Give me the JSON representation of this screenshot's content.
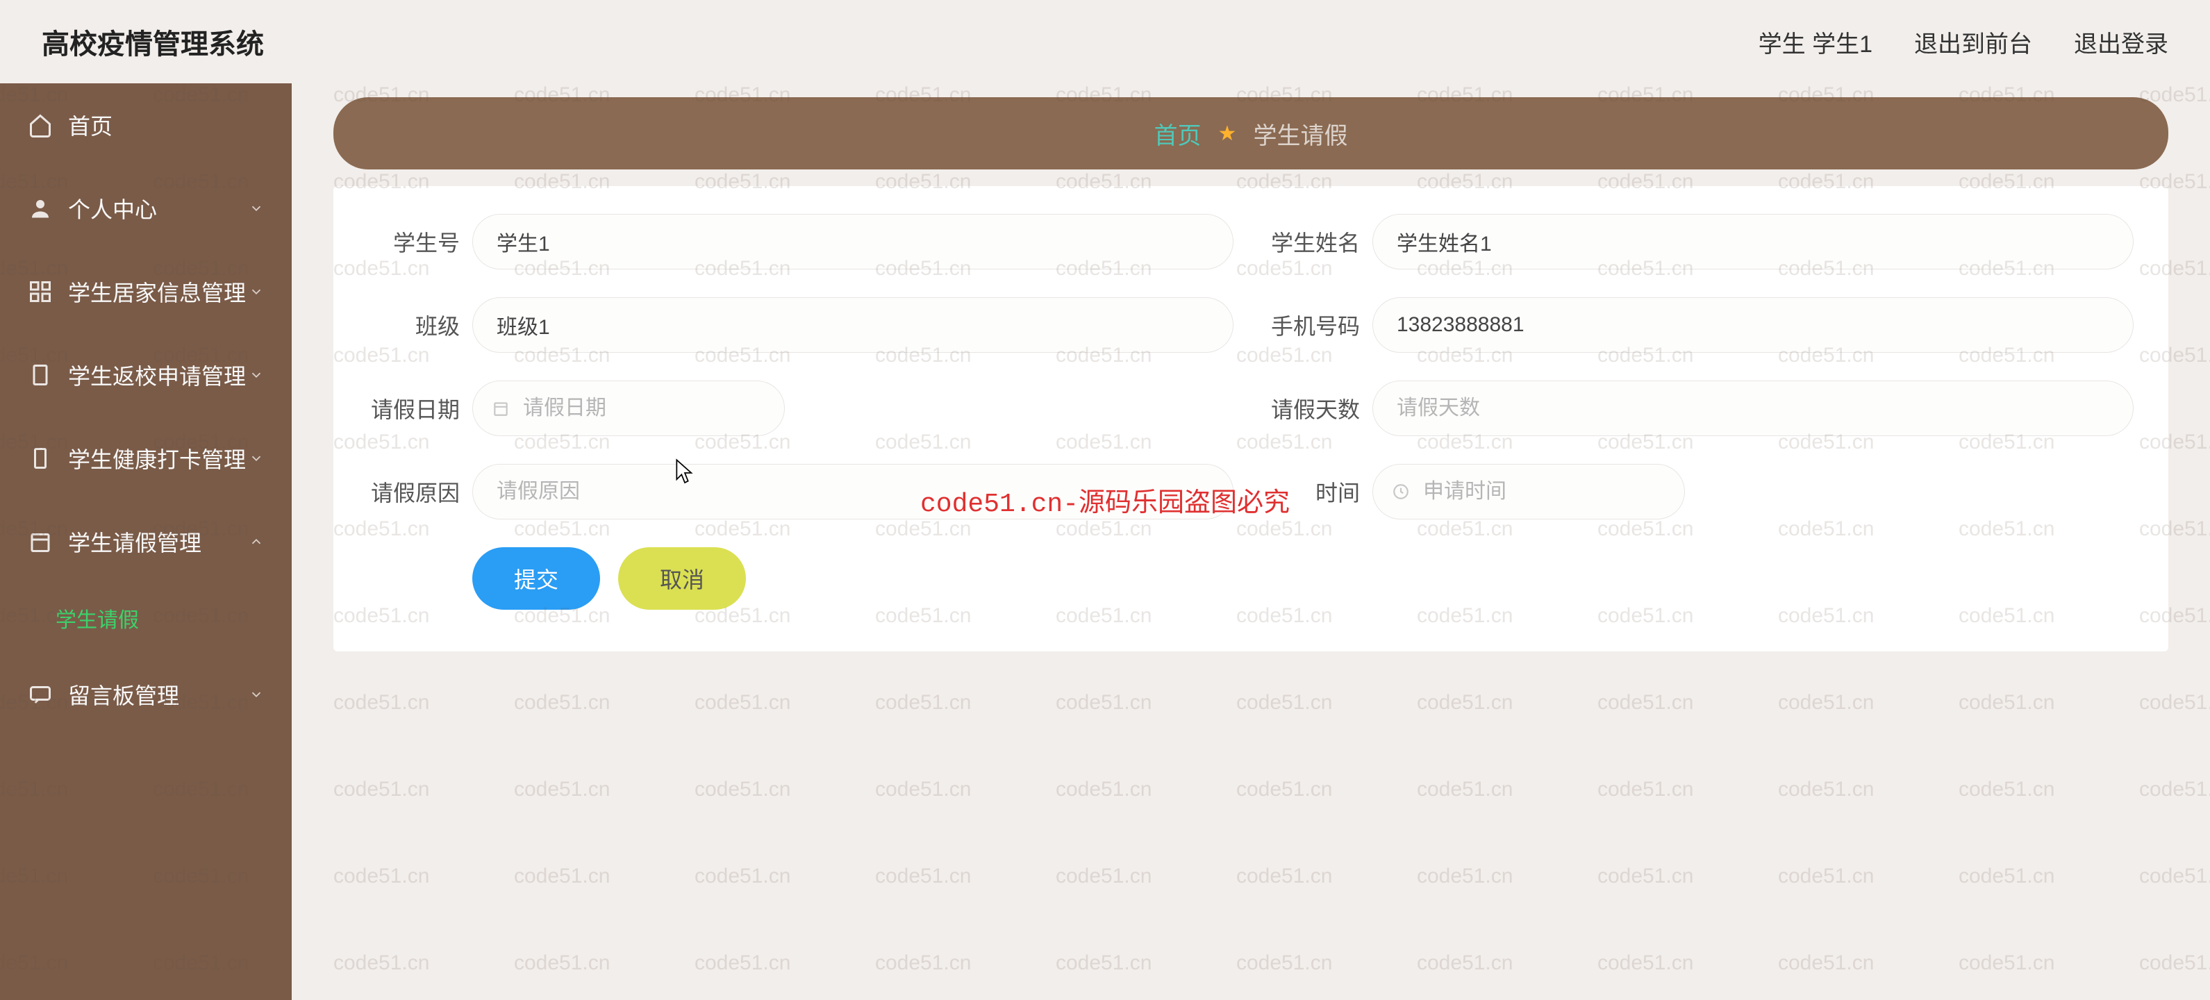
{
  "header": {
    "title": "高校疫情管理系统",
    "user_label": "学生 学生1",
    "logout_front": "退出到前台",
    "logout": "退出登录"
  },
  "sidebar": {
    "items": [
      {
        "label": "首页",
        "icon": "home-icon",
        "expandable": false
      },
      {
        "label": "个人中心",
        "icon": "user-icon",
        "expandable": true,
        "expanded": false
      },
      {
        "label": "学生居家信息管理",
        "icon": "grid-icon",
        "expandable": true,
        "expanded": false
      },
      {
        "label": "学生返校申请管理",
        "icon": "doc-icon",
        "expandable": true,
        "expanded": false
      },
      {
        "label": "学生健康打卡管理",
        "icon": "clipboard-icon",
        "expandable": true,
        "expanded": false
      },
      {
        "label": "学生请假管理",
        "icon": "calendar-icon",
        "expandable": true,
        "expanded": true
      },
      {
        "label": "留言板管理",
        "icon": "message-icon",
        "expandable": true,
        "expanded": false
      }
    ],
    "sub_item": "学生请假"
  },
  "breadcrumb": {
    "home": "首页",
    "current": "学生请假"
  },
  "form": {
    "student_id": {
      "label": "学生号",
      "value": "学生1"
    },
    "student_name": {
      "label": "学生姓名",
      "value": "学生姓名1"
    },
    "class": {
      "label": "班级",
      "value": "班级1"
    },
    "phone": {
      "label": "手机号码",
      "value": "13823888881"
    },
    "leave_date": {
      "label": "请假日期",
      "placeholder": "请假日期"
    },
    "leave_days": {
      "label": "请假天数",
      "placeholder": "请假天数"
    },
    "leave_reason": {
      "label": "请假原因",
      "placeholder": "请假原因"
    },
    "apply_time": {
      "label": "时间",
      "placeholder": "申请时间"
    }
  },
  "buttons": {
    "submit": "提交",
    "cancel": "取消"
  },
  "watermark": {
    "text": "code51.cn",
    "center_text": "code51.cn-源码乐园盗图必究"
  }
}
